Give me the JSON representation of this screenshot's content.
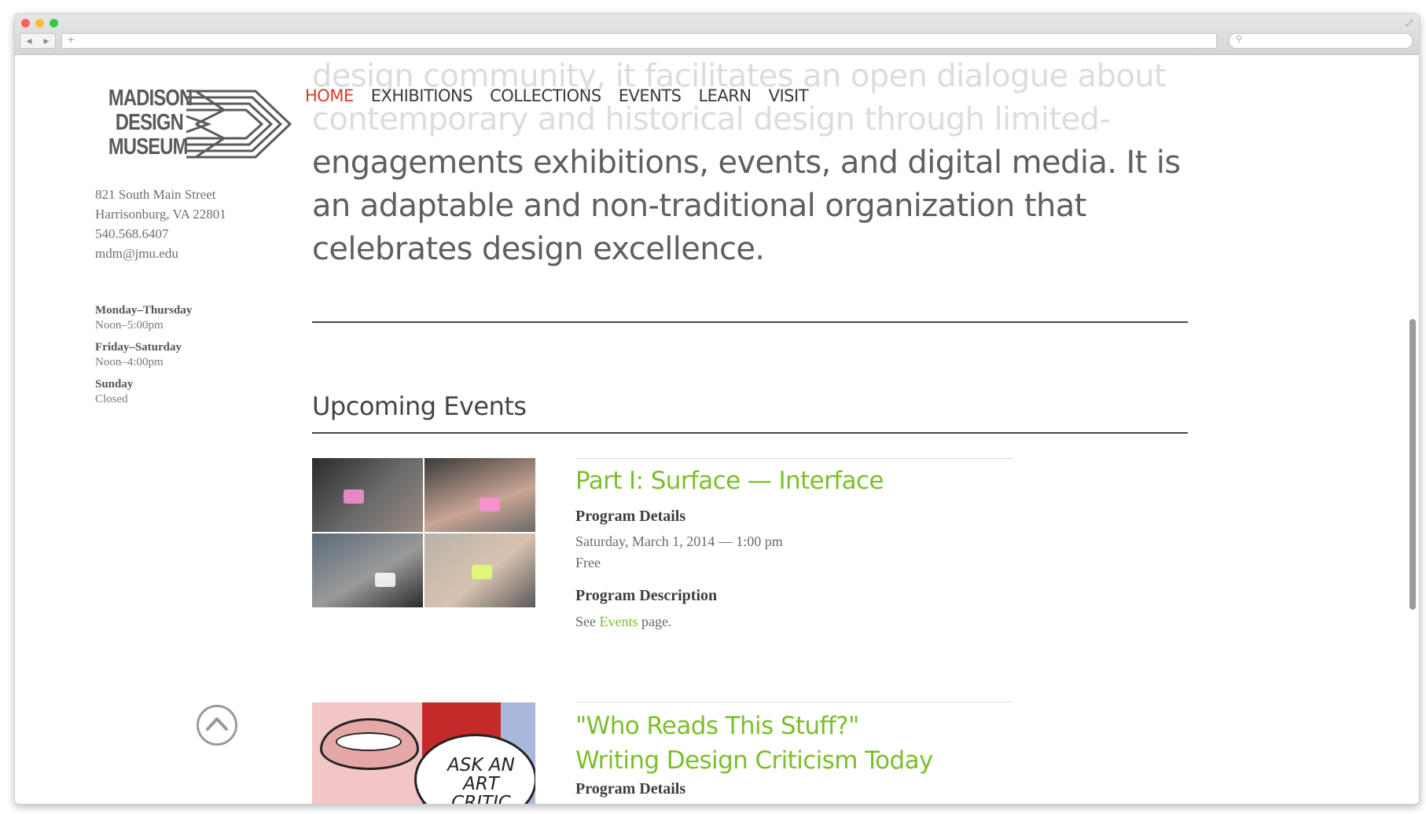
{
  "museum": {
    "logo_lines": [
      "MADISON",
      "DESIGN",
      "MUSEUM"
    ],
    "address": [
      "821 South Main Street",
      "Harrisonburg, VA 22801",
      "540.568.6407",
      "mdm@jmu.edu"
    ],
    "hours": [
      {
        "day": "Monday–Thursday",
        "time": "Noon–5:00pm"
      },
      {
        "day": "Friday–Saturday",
        "time": "Noon–4:00pm"
      },
      {
        "day": "Sunday",
        "time": "Closed"
      }
    ]
  },
  "nav": {
    "items": [
      "HOME",
      "EXHIBITIONS",
      "COLLECTIONS",
      "EVENTS",
      "LEARN",
      "VISIT"
    ],
    "active": "HOME"
  },
  "intro": {
    "faded_line_1": "design community, it facilitates an open dialogue about",
    "faded_line_2": "contemporary and historical design through limited-",
    "text": "engagements exhibitions, events, and digital media. It is an adaptable and non-traditional organization that celebrates design excellence."
  },
  "events_section": {
    "title": "Upcoming Events",
    "events": [
      {
        "title": "Part I: Surface — Interface",
        "details_label": "Program Details",
        "date": "Saturday, March 1, 2014 — 1:00 pm",
        "price": "Free",
        "description_label": "Program Description",
        "desc_prefix": "See ",
        "desc_link": "Events",
        "desc_suffix": " page."
      },
      {
        "title_line_1": "\"Who Reads This Stuff?\"",
        "title_line_2": "Writing Design Criticism Today",
        "details_label": "Program Details",
        "image_text_1": "ASK AN",
        "image_text_2": "ART CRITIC"
      }
    ]
  },
  "colors": {
    "accent_green": "#7bbf2a",
    "active_red": "#d83a2b",
    "text_gray": "#5f5f5f"
  },
  "icons": {
    "back_to_top": "chevron-up-circle-icon"
  }
}
